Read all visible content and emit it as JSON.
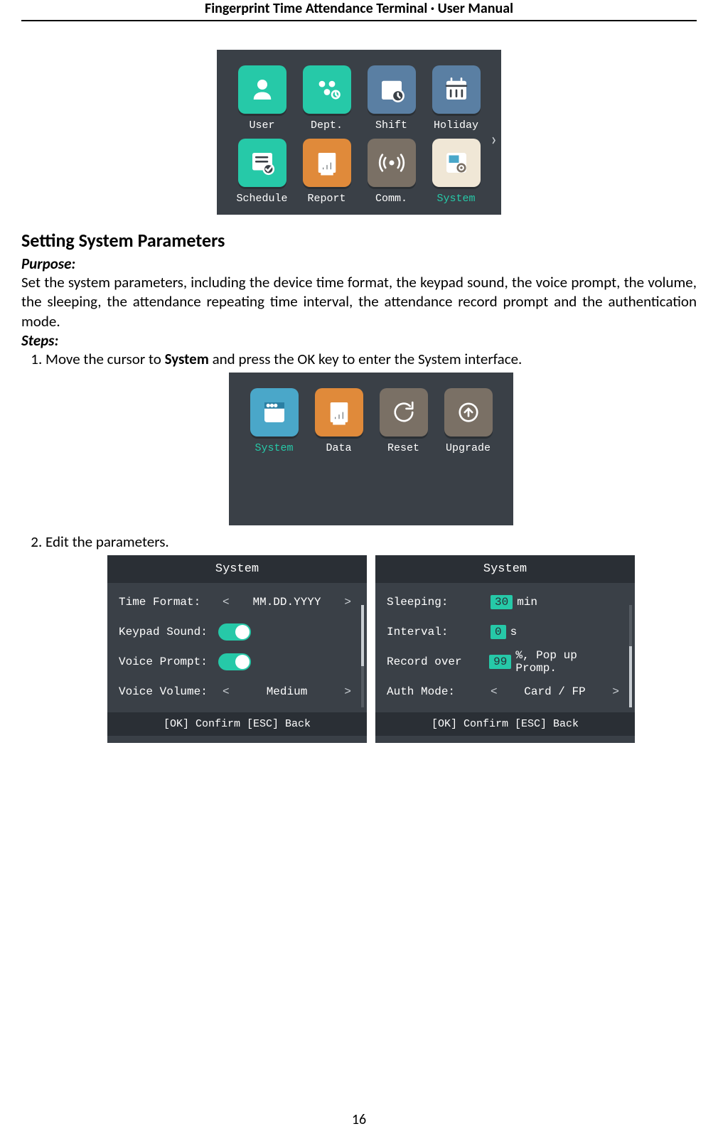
{
  "header": "Fingerprint Time Attendance Terminal · User Manual",
  "page_number": "16",
  "fig1": {
    "items": [
      {
        "label": "User",
        "color": "#26c9a8",
        "icon": "person"
      },
      {
        "label": "Dept.",
        "color": "#26c9a8",
        "icon": "group"
      },
      {
        "label": "Shift",
        "color": "#5a7fa3",
        "icon": "clock"
      },
      {
        "label": "Holiday",
        "color": "#5a7fa3",
        "icon": "calendar"
      },
      {
        "label": "Schedule",
        "color": "#26c9a8",
        "icon": "schedule"
      },
      {
        "label": "Report",
        "color": "#e08a3a",
        "icon": "report"
      },
      {
        "label": "Comm.",
        "color": "#7a7065",
        "icon": "wave"
      },
      {
        "label": "System",
        "color": "#f0e7d6",
        "icon": "gear",
        "selected": true
      }
    ]
  },
  "section_title": "Setting System Parameters",
  "purpose_label": "Purpose:",
  "purpose_body": "Set the system parameters, including the device time format, the keypad sound, the voice prompt, the volume, the sleeping, the attendance repeating time interval, the attendance record prompt and the authentication mode.",
  "steps_label": "Steps:",
  "step1_pre": "Move the cursor to ",
  "step1_strong": "System",
  "step1_post": " and press the OK key to enter the System interface.",
  "fig2": {
    "items": [
      {
        "label": "System",
        "color": "#4aa7c9",
        "icon": "window",
        "selected": true
      },
      {
        "label": "Data",
        "color": "#e08a3a",
        "icon": "report"
      },
      {
        "label": "Reset",
        "color": "#7a7065",
        "icon": "reset"
      },
      {
        "label": "Upgrade",
        "color": "#7a7065",
        "icon": "up"
      }
    ]
  },
  "step2": "Edit the parameters.",
  "panelA": {
    "title": "System",
    "rows": [
      {
        "label": "Time Format:",
        "type": "chev",
        "value": "MM.DD.YYYY"
      },
      {
        "label": "Keypad Sound:",
        "type": "toggle"
      },
      {
        "label": "Voice Prompt:",
        "type": "toggle"
      },
      {
        "label": "Voice Volume:",
        "type": "chev",
        "value": "Medium"
      }
    ],
    "footer": "[OK] Confirm   [ESC] Back"
  },
  "panelB": {
    "title": "System",
    "rows": [
      {
        "label": "Sleeping:",
        "type": "pill",
        "value": "30",
        "suffix": "min"
      },
      {
        "label": "Interval:",
        "type": "pill",
        "value": "0",
        "suffix": "s"
      },
      {
        "label": "Record over",
        "type": "pill",
        "value": "99",
        "suffix": "%, Pop up Promp."
      },
      {
        "label": "Auth Mode:",
        "type": "chev",
        "value": "Card / FP"
      }
    ],
    "footer": "[OK] Confirm   [ESC] Back"
  }
}
